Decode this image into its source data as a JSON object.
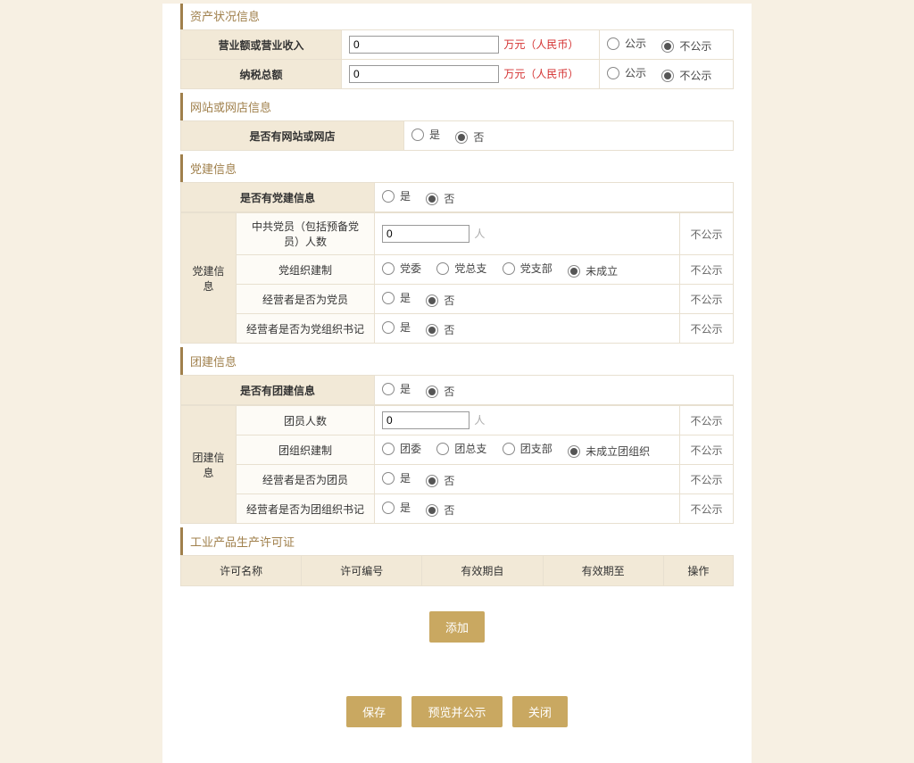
{
  "sections": {
    "assets": {
      "title": "资产状况信息",
      "rows": [
        {
          "label": "营业额或营业收入",
          "value": "0",
          "unit": "万元（人民币）",
          "pub": "公示",
          "nopub": "不公示"
        },
        {
          "label": "纳税总额",
          "value": "0",
          "unit": "万元（人民币）",
          "pub": "公示",
          "nopub": "不公示"
        }
      ]
    },
    "website": {
      "title": "网站或网店信息",
      "label": "是否有网站或网店",
      "yes": "是",
      "no": "否"
    },
    "party": {
      "title": "党建信息",
      "has_label": "是否有党建信息",
      "yes": "是",
      "no": "否",
      "rowspan_label": "党建信息",
      "rows": {
        "members": {
          "label": "中共党员（包括预备党员）人数",
          "value": "0",
          "unit": "人",
          "nopub": "不公示"
        },
        "org": {
          "label": "党组织建制",
          "opts": [
            "党委",
            "党总支",
            "党支部",
            "未成立"
          ],
          "nopub": "不公示"
        },
        "operator_member": {
          "label": "经营者是否为党员",
          "yes": "是",
          "no": "否",
          "nopub": "不公示"
        },
        "operator_secretary": {
          "label": "经营者是否为党组织书记",
          "yes": "是",
          "no": "否",
          "nopub": "不公示"
        }
      }
    },
    "youth": {
      "title": "团建信息",
      "has_label": "是否有团建信息",
      "yes": "是",
      "no": "否",
      "rowspan_label": "团建信息",
      "rows": {
        "members": {
          "label": "团员人数",
          "value": "0",
          "unit": "人",
          "nopub": "不公示"
        },
        "org": {
          "label": "团组织建制",
          "opts": [
            "团委",
            "团总支",
            "团支部",
            "未成立团组织"
          ],
          "nopub": "不公示"
        },
        "operator_member": {
          "label": "经营者是否为团员",
          "yes": "是",
          "no": "否",
          "nopub": "不公示"
        },
        "operator_secretary": {
          "label": "经营者是否为团组织书记",
          "yes": "是",
          "no": "否",
          "nopub": "不公示"
        }
      }
    },
    "license": {
      "title": "工业产品生产许可证",
      "headers": [
        "许可名称",
        "许可编号",
        "有效期自",
        "有效期至",
        "操作"
      ],
      "add_btn": "添加"
    }
  },
  "buttons": {
    "save": "保存",
    "preview": "预览并公示",
    "close": "关闭"
  }
}
